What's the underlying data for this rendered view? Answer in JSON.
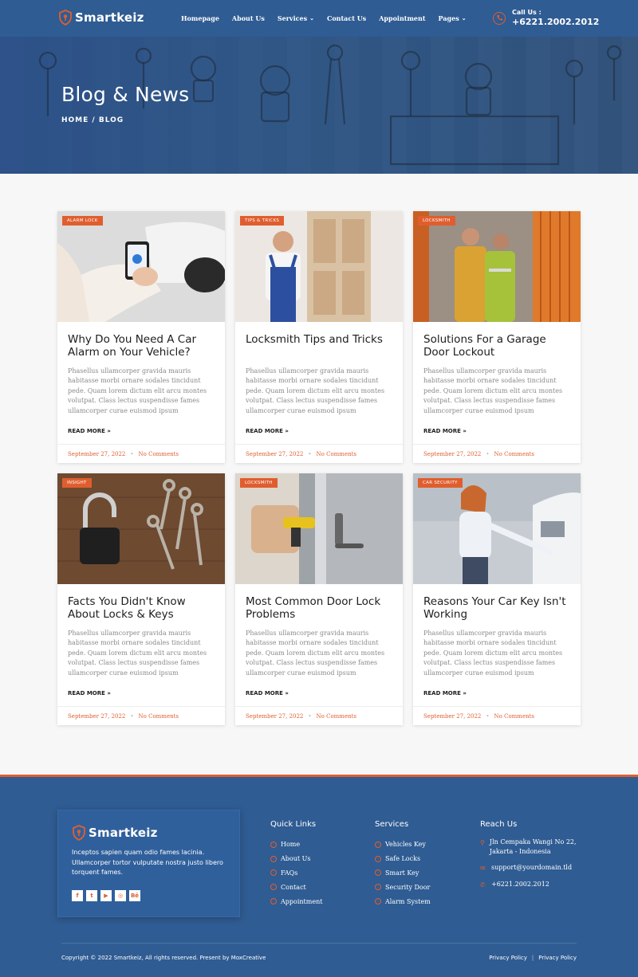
{
  "header": {
    "brand": "Smartkeiz",
    "nav": [
      {
        "label": "Homepage",
        "dropdown": false
      },
      {
        "label": "About Us",
        "dropdown": false
      },
      {
        "label": "Services",
        "dropdown": true
      },
      {
        "label": "Contact Us",
        "dropdown": false
      },
      {
        "label": "Appointment",
        "dropdown": false
      },
      {
        "label": "Pages",
        "dropdown": true
      }
    ],
    "call_label": "Call Us :",
    "call_number": "+6221.2002.2012"
  },
  "hero": {
    "title": "Blog & News",
    "breadcrumb": "HOME  /  BLOG"
  },
  "posts": [
    {
      "tag": "ALARM LOCK",
      "title": "Why Do You Need A Car Alarm on Your Vehicle?",
      "excerpt": "Phasellus ullamcorper gravida mauris habitasse morbi ornare sodales tincidunt pede. Quam lorem dictum elit arcu montes volutpat. Class lectus suspendisse fames ullamcorper curae euismod ipsum",
      "read_more": "READ MORE »",
      "date": "September 27, 2022",
      "comments": "No Comments"
    },
    {
      "tag": "TIPS & TRICKS",
      "title": "Locksmith Tips and Tricks",
      "excerpt": "Phasellus ullamcorper gravida mauris habitasse morbi ornare sodales tincidunt pede. Quam lorem dictum elit arcu montes volutpat. Class lectus suspendisse fames ullamcorper curae euismod ipsum",
      "read_more": "READ MORE »",
      "date": "September 27, 2022",
      "comments": "No Comments"
    },
    {
      "tag": "LOCKSMITH",
      "title": "Solutions For a Garage Door Lockout",
      "excerpt": "Phasellus ullamcorper gravida mauris habitasse morbi ornare sodales tincidunt pede. Quam lorem dictum elit arcu montes volutpat. Class lectus suspendisse fames ullamcorper curae euismod ipsum",
      "read_more": "READ MORE »",
      "date": "September 27, 2022",
      "comments": "No Comments"
    },
    {
      "tag": "INSIGHT",
      "title": "Facts You Didn't Know About Locks & Keys",
      "excerpt": "Phasellus ullamcorper gravida mauris habitasse morbi ornare sodales tincidunt pede. Quam lorem dictum elit arcu montes volutpat. Class lectus suspendisse fames ullamcorper curae euismod ipsum",
      "read_more": "READ MORE »",
      "date": "September 27, 2022",
      "comments": "No Comments"
    },
    {
      "tag": "LOCKSMITH",
      "title": "Most Common Door Lock Problems",
      "excerpt": "Phasellus ullamcorper gravida mauris habitasse morbi ornare sodales tincidunt pede. Quam lorem dictum elit arcu montes volutpat. Class lectus suspendisse fames ullamcorper curae euismod ipsum",
      "read_more": "READ MORE »",
      "date": "September 27, 2022",
      "comments": "No Comments"
    },
    {
      "tag": "CAR SECURITY",
      "title": "Reasons Your Car Key Isn't Working",
      "excerpt": "Phasellus ullamcorper gravida mauris habitasse morbi ornare sodales tincidunt pede. Quam lorem dictum elit arcu montes volutpat. Class lectus suspendisse fames ullamcorper curae euismod ipsum",
      "read_more": "READ MORE »",
      "date": "September 27, 2022",
      "comments": "No Comments"
    }
  ],
  "footer": {
    "brand": "Smartkeiz",
    "description": "Inceptos sapien quam odio fames lacinia. Ullamcorper tortor vulputate nostra justo libero torquent fames.",
    "socials": [
      {
        "icon": "facebook-icon",
        "glyph": "f"
      },
      {
        "icon": "twitter-icon",
        "glyph": "t"
      },
      {
        "icon": "youtube-icon",
        "glyph": "▶"
      },
      {
        "icon": "instagram-icon",
        "glyph": "◎"
      },
      {
        "icon": "behance-icon",
        "glyph": "Bē"
      }
    ],
    "quick_links_title": "Quick Links",
    "quick_links": [
      "Home",
      "About Us",
      "FAQs",
      "Contact",
      "Appointment"
    ],
    "services_title": "Services",
    "services": [
      "Vehicles Key",
      "Safe Locks",
      "Smart Key",
      "Security Door",
      "Alarm System"
    ],
    "reach_title": "Reach Us",
    "address": "Jln Cempaka Wangi No 22, Jakarta - Indonesia",
    "email": "support@yourdomain.tld",
    "phone": "+6221.2002.2012",
    "copyright": "Copyright © 2022 Smartkeiz, All rights reserved. Present by MoxCreative",
    "policy_1": "Privacy Policy",
    "policy_2": "Privacy Policy"
  },
  "colors": {
    "primary": "#2f5c93",
    "accent": "#e05e2e"
  }
}
